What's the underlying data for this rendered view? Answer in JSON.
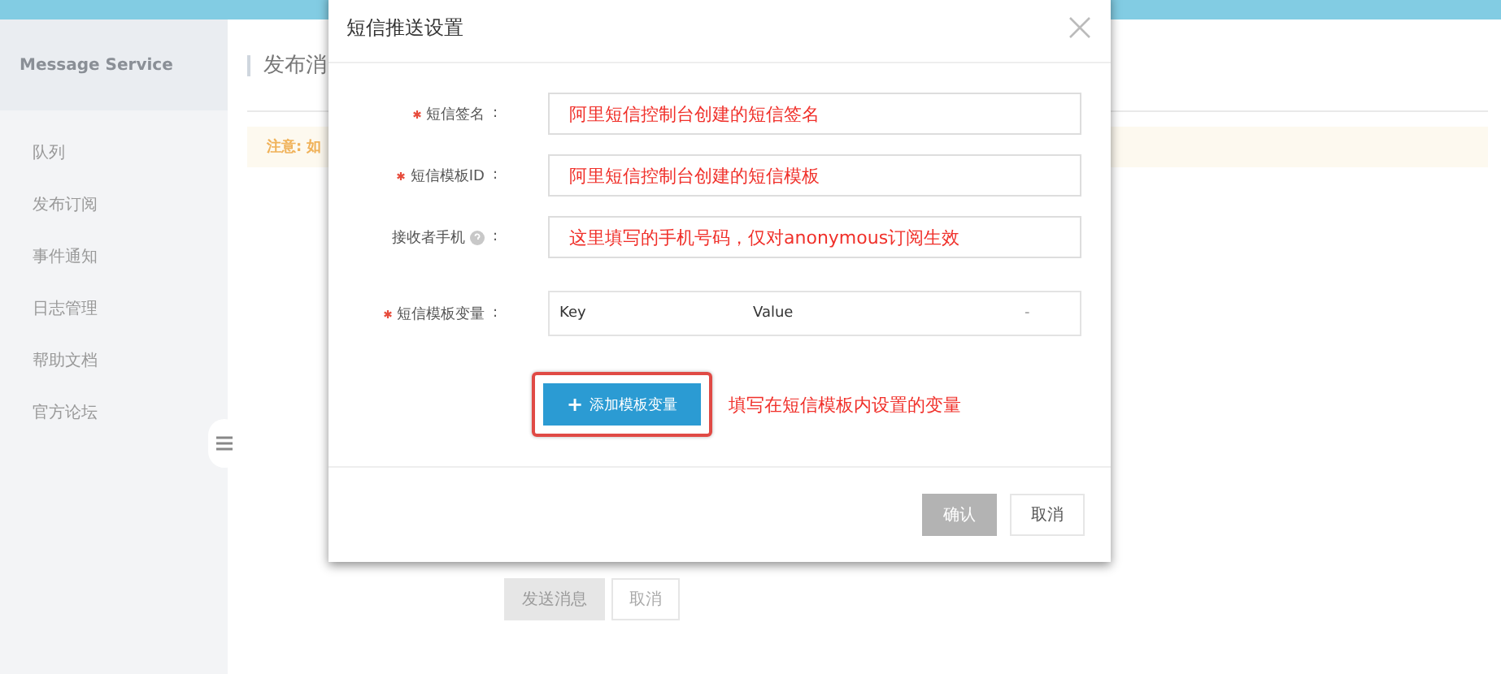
{
  "sidebar": {
    "title": "Message Service",
    "items": [
      {
        "label": "队列"
      },
      {
        "label": "发布订阅"
      },
      {
        "label": "事件通知"
      },
      {
        "label": "日志管理"
      },
      {
        "label": "帮助文档"
      },
      {
        "label": "官方论坛"
      }
    ]
  },
  "main": {
    "title": "发布消",
    "notice": "注意: 如",
    "buttons": [
      {
        "label": "发送消息",
        "disabled": true
      },
      {
        "label": "取消",
        "disabled": false
      }
    ]
  },
  "dialog": {
    "title": "短信推送设置",
    "fields": [
      {
        "label": "短信签名",
        "required": true,
        "help": false,
        "colon": ":",
        "value": "阿里短信控制台创建的短信签名"
      },
      {
        "label": "短信模板ID",
        "required": true,
        "help": false,
        "colon": ":",
        "value": "阿里短信控制台创建的短信模板"
      },
      {
        "label": "接收者手机",
        "required": false,
        "help": true,
        "colon": ":",
        "value": "这里填写的手机号码，仅对anonymous订阅生效"
      }
    ],
    "variables": {
      "label": "短信模板变量",
      "required": true,
      "help": false,
      "colon": ":",
      "columns": [
        "Key",
        "Value",
        "-"
      ]
    },
    "add_button": {
      "icon": "+",
      "label": "添加模板变量"
    },
    "annotation": "填写在短信模板内设置的变量",
    "buttons": [
      {
        "label": "确认",
        "disabled": true
      },
      {
        "label": "取消",
        "disabled": false
      }
    ]
  }
}
